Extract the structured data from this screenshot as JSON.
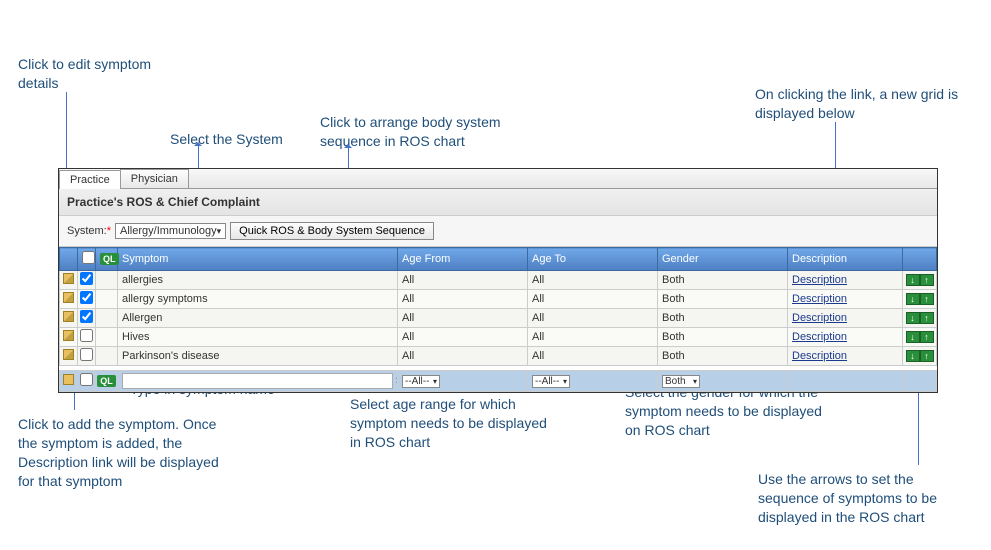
{
  "annotations": {
    "edit": "Click to edit symptom details",
    "select_system": "Select the System",
    "sequence_btn": "Click to arrange body system sequence in ROS chart",
    "desc_link": "On clicking the link, a new grid is displayed below",
    "type_name": "Type in symptom name",
    "add_symptom": "Click to add the symptom. Once the symptom is added, the Description link will be displayed for that symptom",
    "age_range": "Select age range for which symptom needs to be displayed in ROS chart",
    "gender": "Select the gender for which the symptom needs to be displayed on ROS chart",
    "arrows": "Use the arrows to set the sequence of symptoms to be displayed in the ROS chart"
  },
  "tabs": {
    "practice": "Practice",
    "physician": "Physician"
  },
  "section_title": "Practice's ROS & Chief Complaint",
  "toolbar": {
    "system_label": "System:",
    "system_value": "Allergy/Immunology",
    "seq_btn": "Quick ROS & Body System Sequence"
  },
  "columns": {
    "ql": "QL",
    "symptom": "Symptom",
    "age_from": "Age From",
    "age_to": "Age To",
    "gender": "Gender",
    "description": "Description"
  },
  "rows": [
    {
      "checked": true,
      "name": "allergies",
      "age_from": "All",
      "age_to": "All",
      "gender": "Both",
      "desc": "Description"
    },
    {
      "checked": true,
      "name": "allergy symptoms",
      "age_from": "All",
      "age_to": "All",
      "gender": "Both",
      "desc": "Description"
    },
    {
      "checked": true,
      "name": "Allergen",
      "age_from": "All",
      "age_to": "All",
      "gender": "Both",
      "desc": "Description"
    },
    {
      "checked": false,
      "name": "Hives",
      "age_from": "All",
      "age_to": "All",
      "gender": "Both",
      "desc": "Description"
    },
    {
      "checked": false,
      "name": "Parkinson's disease",
      "age_from": "All",
      "age_to": "All",
      "gender": "Both",
      "desc": "Description"
    }
  ],
  "new_row": {
    "age_from": "--All--",
    "age_to": "--All--",
    "gender": "Both",
    "name_value": ""
  }
}
